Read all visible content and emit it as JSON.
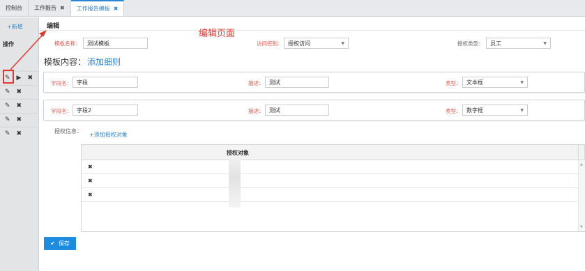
{
  "tabs": [
    {
      "label": "控制台",
      "active": false,
      "closable": false
    },
    {
      "label": "工作报告",
      "active": false,
      "closable": true
    },
    {
      "label": "工作报告模板",
      "active": true,
      "closable": true
    }
  ],
  "sidebar": {
    "add_label": "+新增",
    "ops_header": "操作",
    "rows": [
      {
        "icons": [
          "pencil-icon",
          "play-icon",
          "close-icon"
        ]
      },
      {
        "icons": [
          "pencil-icon",
          "close-icon"
        ]
      },
      {
        "icons": [
          "pencil-icon",
          "close-icon"
        ]
      },
      {
        "icons": [
          "pencil-icon",
          "close-icon"
        ]
      },
      {
        "icons": [
          "pencil-icon",
          "close-icon"
        ]
      }
    ]
  },
  "editor": {
    "tab_label": "编辑",
    "annotation": "编辑页面",
    "template_name_label": "模板名称：",
    "template_name_value": "测试模板",
    "access_label": "访问控制：",
    "access_value": "授权访问",
    "auth_type_label": "授权类型：",
    "auth_type_value": "员工"
  },
  "content": {
    "title": "模板内容：",
    "add_detail": "添加细则",
    "fields": [
      {
        "name_label": "字段名：",
        "name_value": "字段",
        "desc_label": "描述：",
        "desc_value": "测试",
        "type_label": "类型：",
        "type_value": "文本框"
      },
      {
        "name_label": "字段名：",
        "name_value": "字段2",
        "desc_label": "描述：",
        "desc_value": "测试",
        "type_label": "类型：",
        "type_value": "数字框"
      }
    ]
  },
  "auth": {
    "label": "授权信息：",
    "add_label": "+添加授权对象",
    "column_header": "授权对象",
    "rows": [
      "✖",
      "✖",
      "✖"
    ]
  },
  "save_label": "保存",
  "colors": {
    "accent": "#2b87d1",
    "highlight": "#e0382f",
    "save_button": "#1c8be0"
  },
  "icon_glyphs": {
    "pencil": "✎",
    "play": "▶",
    "close": "✖",
    "check": "✔",
    "caret_down": "▼"
  }
}
